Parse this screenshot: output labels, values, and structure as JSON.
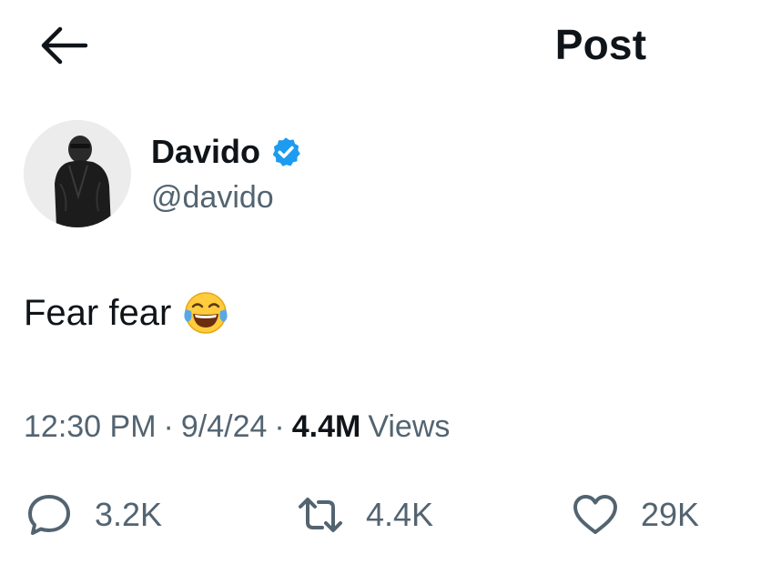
{
  "header": {
    "title": "Post",
    "back_icon": "arrow-left-icon"
  },
  "author": {
    "display_name": "Davido",
    "handle": "@davido",
    "verified": true,
    "verified_color": "#1d9bf0"
  },
  "tweet": {
    "text": "Fear fear",
    "emoji": "face-with-tears-of-joy-icon"
  },
  "meta": {
    "time": "12:30 PM",
    "separator": "·",
    "date": "9/4/24",
    "views_count": "4.4M",
    "views_label": "Views"
  },
  "actions": {
    "reply": {
      "icon": "reply-icon",
      "count": "3.2K"
    },
    "repost": {
      "icon": "repost-icon",
      "count": "4.4K"
    },
    "like": {
      "icon": "heart-icon",
      "count": "29K"
    }
  },
  "colors": {
    "text_primary": "#0f1419",
    "text_secondary": "#536471",
    "accent": "#1d9bf0"
  }
}
